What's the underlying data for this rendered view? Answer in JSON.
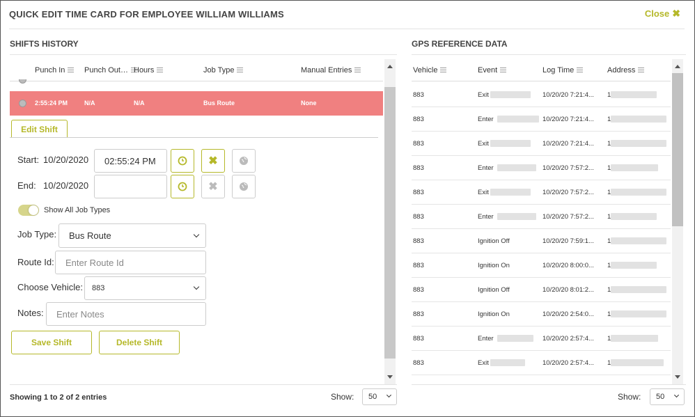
{
  "title": "QUICK EDIT TIME CARD FOR EMPLOYEE WILLIAM WILLIAMS",
  "close_label": "Close",
  "accent_color": "#b5b829",
  "highlight_color": "#f08080",
  "shifts": {
    "section_title": "SHIFTS HISTORY",
    "columns": [
      "Punch In",
      "Punch Out",
      "Hours",
      "Job Type",
      "Manual Entries"
    ],
    "columns_display": [
      "Punch In",
      "Punch Out…",
      "Hours",
      "Job Type",
      "Manual Entries"
    ],
    "selected_row": {
      "punch_in": "2:55:24 PM",
      "punch_out": "N/A",
      "hours": "N/A",
      "job_type": "Bus Route",
      "manual_entries": "None"
    },
    "edit_tab_label": "Edit Shift",
    "start_label": "Start:",
    "start_date": "10/20/2020",
    "start_time": "02:55:24 PM",
    "end_label": "End:",
    "end_date": "10/20/2020",
    "end_time": "",
    "toggle_label": "Show All Job Types",
    "job_type_label": "Job Type:",
    "job_type_value": "Bus Route",
    "route_id_label": "Route Id:",
    "route_id_placeholder": "Enter Route Id",
    "vehicle_label": "Choose Vehicle:",
    "vehicle_value": "883",
    "notes_label": "Notes:",
    "notes_placeholder": "Enter Notes",
    "save_label": "Save Shift",
    "delete_label": "Delete Shift",
    "footer_text": "Showing 1 to 2 of 2 entries",
    "show_label": "Show:",
    "show_value": "50"
  },
  "gps": {
    "section_title": "GPS REFERENCE DATA",
    "columns": [
      "Vehicle",
      "Event",
      "Log Time",
      "Address"
    ],
    "rows": [
      {
        "vehicle": "883",
        "event": "Exit",
        "log_time": "10/20/20 7:21:4...",
        "address": "1"
      },
      {
        "vehicle": "883",
        "event": "Enter",
        "log_time": "10/20/20 7:21:4...",
        "address": "1"
      },
      {
        "vehicle": "883",
        "event": "Exit",
        "log_time": "10/20/20 7:21:4...",
        "address": "1"
      },
      {
        "vehicle": "883",
        "event": "Enter",
        "log_time": "10/20/20 7:57:2...",
        "address": "1"
      },
      {
        "vehicle": "883",
        "event": "Exit",
        "log_time": "10/20/20 7:57:2...",
        "address": "1"
      },
      {
        "vehicle": "883",
        "event": "Enter",
        "log_time": "10/20/20 7:57:2...",
        "address": "1"
      },
      {
        "vehicle": "883",
        "event": "Ignition Off",
        "log_time": "10/20/20 7:59:1...",
        "address": "1"
      },
      {
        "vehicle": "883",
        "event": "Ignition On",
        "log_time": "10/20/20 8:00:0...",
        "address": "1"
      },
      {
        "vehicle": "883",
        "event": "Ignition Off",
        "log_time": "10/20/20 8:01:2...",
        "address": "1"
      },
      {
        "vehicle": "883",
        "event": "Ignition On",
        "log_time": "10/20/20 2:54:0...",
        "address": "1"
      },
      {
        "vehicle": "883",
        "event": "Enter",
        "log_time": "10/20/20 2:57:4...",
        "address": "1"
      },
      {
        "vehicle": "883",
        "event": "Exit",
        "log_time": "10/20/20 2:57:4...",
        "address": "1"
      }
    ],
    "show_label": "Show:",
    "show_value": "50"
  }
}
